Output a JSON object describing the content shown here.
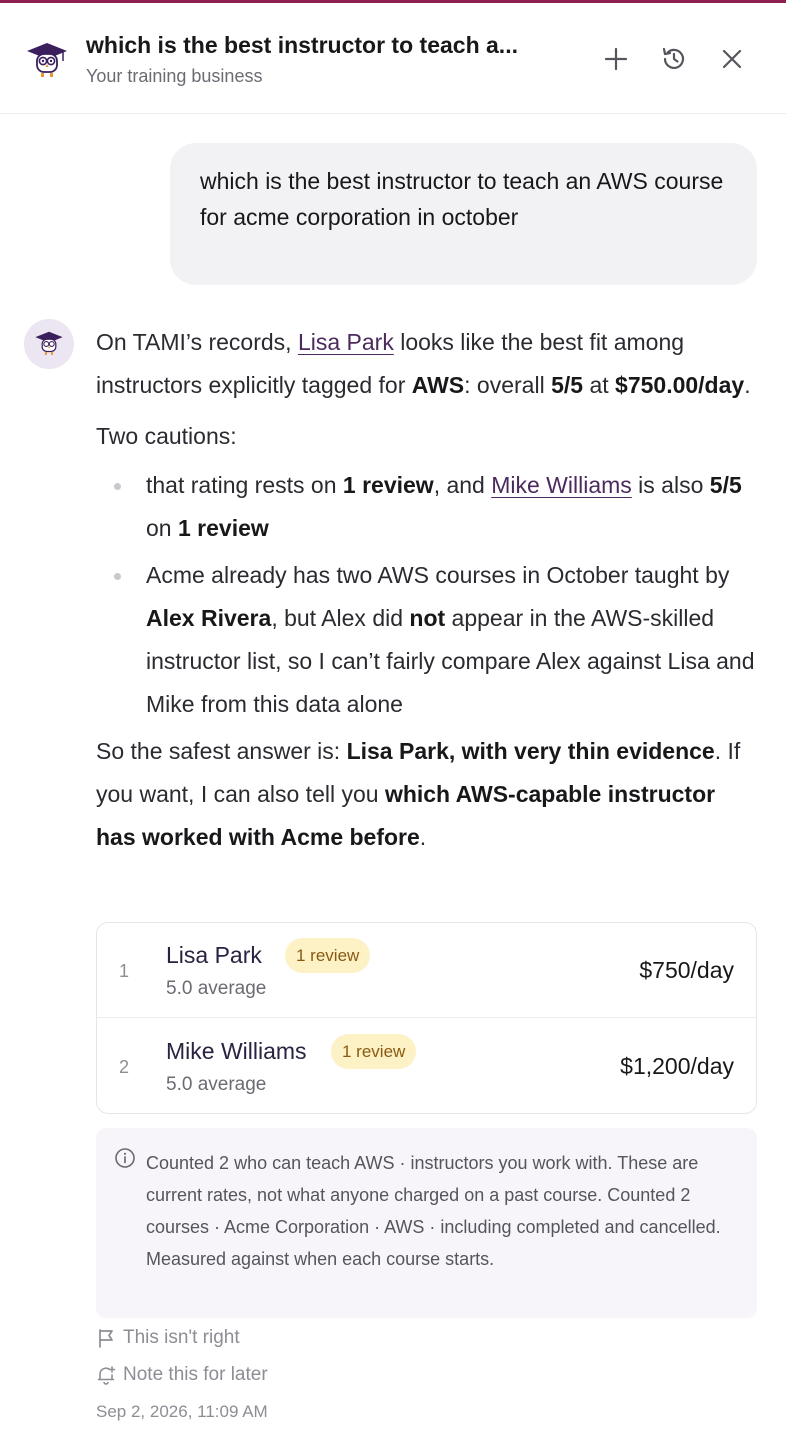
{
  "header": {
    "title": "which is the best instructor to teach a...",
    "subtitle": "Your training business",
    "icons": {
      "logo": "owl-graduate-logo",
      "new": "plus-icon",
      "history": "history-icon",
      "close": "close-icon"
    }
  },
  "user_message": "which is the best instructor to teach an AWS course for acme corporation in october",
  "answer": {
    "p1": {
      "t1": "On TAMI’s records, ",
      "link1": "Lisa Park",
      "t2": " looks like the best fit among instructors explicitly tagged for ",
      "b1": "AWS",
      "t3": ": overall ",
      "b2": "5/5",
      "t4": " at ",
      "b3": "$750.00/day",
      "t5": "."
    },
    "p2": "Two cautions:",
    "bullet1": {
      "t1": "that rating rests on ",
      "b1": "1 review",
      "t2": ", and ",
      "link1": "Mike Williams",
      "t3": " is also ",
      "b2": "5/5",
      "t4": " on ",
      "b3": "1 review"
    },
    "bullet2": {
      "t1": "Acme already has two AWS courses in October taught by ",
      "b1": "Alex Rivera",
      "t2": ", but Alex did ",
      "b2": "not",
      "t3": " appear in the AWS-skilled instructor list, so I can’t fairly compare Alex against Lisa and Mike from this data alone"
    },
    "p3": {
      "t1": "So the safest answer is: ",
      "b1": "Lisa Park,  with very thin evidence",
      "t2": ". If you want, I can also tell you ",
      "b2": "which AWS-capable instructor has worked with Acme before",
      "t3": "."
    }
  },
  "instructors": [
    {
      "rank": "1",
      "name": "Lisa Park",
      "badge": "1 review",
      "average": "5.0 average",
      "price": "$750/day"
    },
    {
      "rank": "2",
      "name": "Mike Williams",
      "badge": "1 review",
      "average": "5.0 average",
      "price": "$1,200/day"
    }
  ],
  "note": {
    "icon": "info-icon",
    "text": "Counted 2 who can teach AWS · instructors you work with. These are current rates, not what anyone charged on a past course. Counted 2 courses · Acme Corporation · AWS · including completed and cancelled. Measured against when each course starts."
  },
  "actions": [
    {
      "icon": "flag-icon",
      "label": "This isn't right"
    },
    {
      "icon": "bell-plus-icon",
      "label": "Note this for later"
    }
  ],
  "timestamp": "Sep 2, 2026, 11:09 AM",
  "colors": {
    "accent": "#8e1f4e",
    "link": "#4c2a5e",
    "badge_bg": "#fdf1c6",
    "note_bg": "#f7f5fa"
  }
}
